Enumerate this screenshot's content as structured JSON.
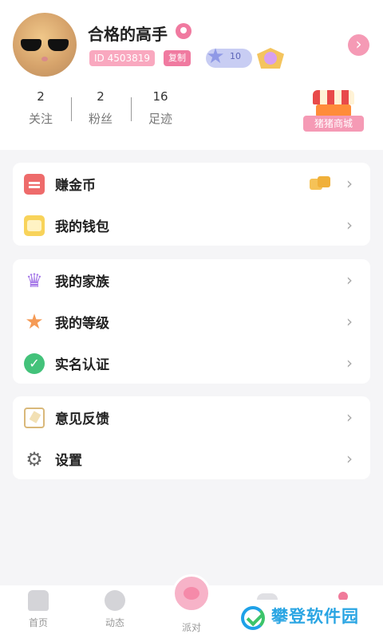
{
  "profile": {
    "username": "合格的高手",
    "id_text": "ID 4503819",
    "copy_label": "复制",
    "level": "10"
  },
  "stats": [
    {
      "value": "2",
      "label": "关注"
    },
    {
      "value": "2",
      "label": "粉丝"
    },
    {
      "value": "16",
      "label": "足迹"
    }
  ],
  "shop_label": "猪猪商城",
  "menu_group_1": [
    {
      "label": "赚金币"
    },
    {
      "label": "我的钱包"
    }
  ],
  "menu_group_2": [
    {
      "label": "我的家族"
    },
    {
      "label": "我的等级"
    },
    {
      "label": "实名认证"
    }
  ],
  "menu_group_3": [
    {
      "label": "意见反馈"
    },
    {
      "label": "设置"
    }
  ],
  "tabbar": {
    "home": "首页",
    "feed": "动态",
    "party": "派对"
  },
  "watermark": "攀登软件园",
  "colors": {
    "accent_pink": "#f07aa0",
    "badge_pink": "#f9a8bf",
    "verify_green": "#43c27a",
    "crown_purple": "#a578e8",
    "star_orange": "#f59a55",
    "watermark_blue": "#2aa5e3"
  },
  "icons": {
    "avatar": "cat-with-sunglasses-avatar",
    "location": "location-pin-icon",
    "level": "star-level-icon",
    "medal": "winged-medal-icon",
    "profile_arrow": "chevron-right-icon",
    "shop": "shop-stall-icon",
    "earn": "coin-purse-icon",
    "coins": "gold-coins-icon",
    "wallet": "wallet-icon",
    "family": "crown-icon",
    "grade": "star-icon",
    "verify": "check-circle-icon",
    "feedback": "pen-note-icon",
    "settings": "gear-icon"
  }
}
